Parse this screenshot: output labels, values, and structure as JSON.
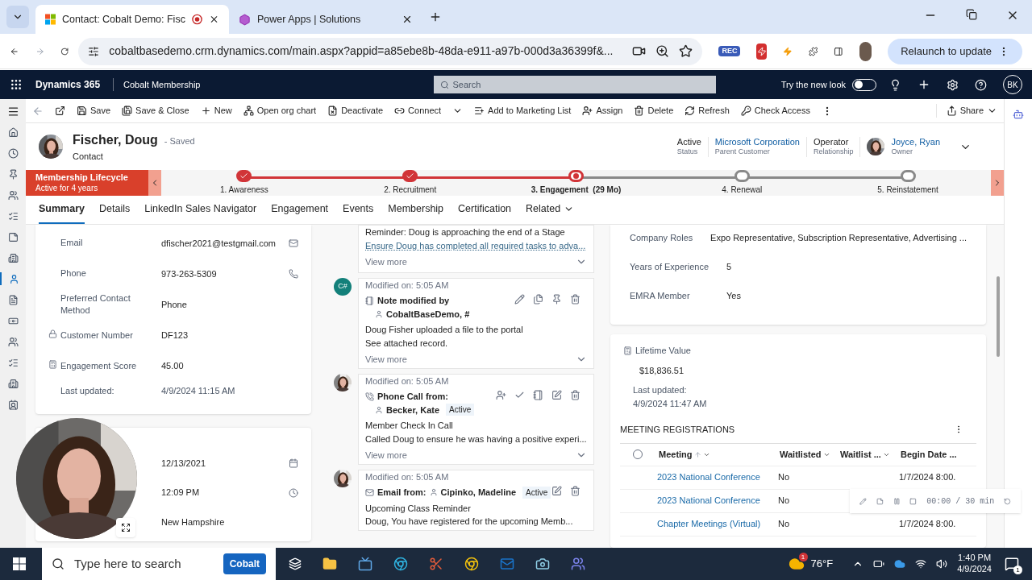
{
  "browser": {
    "tabs": [
      {
        "title": "Contact: Cobalt Demo: Fisc",
        "selected": true
      },
      {
        "title": "Power Apps | Solutions",
        "selected": false
      }
    ],
    "url": "cobaltbasedemo.crm.dynamics.com/main.aspx?appid=a85ebe8b-48da-e911-a97b-000d3a36399f&...",
    "rec": "REC",
    "relaunch": "Relaunch to update"
  },
  "app": {
    "name": "Dynamics 365",
    "area": "Cobalt Membership",
    "search_placeholder": "Search",
    "new_look": {
      "label": "Try the new look",
      "on": false
    },
    "user": "BK"
  },
  "nav_rail": [
    {
      "selected": false
    },
    {
      "selected": false
    },
    {
      "selected": false
    },
    {
      "selected": false
    },
    {
      "selected": false
    },
    {
      "selected": false
    },
    {
      "selected": false
    },
    {
      "selected": true
    },
    {
      "selected": false
    },
    {
      "selected": false
    },
    {
      "selected": false
    },
    {
      "selected": false
    },
    {
      "selected": false
    },
    {
      "selected": false
    }
  ],
  "commands": [
    {
      "kind": "save",
      "label": "Save"
    },
    {
      "kind": "saveclose",
      "label": "Save & Close"
    },
    {
      "kind": "new",
      "label": "New"
    },
    {
      "kind": "org",
      "label": "Open org chart"
    },
    {
      "kind": "deactivate",
      "label": "Deactivate"
    },
    {
      "kind": "connect",
      "label": "Connect"
    },
    {
      "kind": "list",
      "label": "Add to Marketing List"
    },
    {
      "kind": "assign",
      "label": "Assign"
    },
    {
      "kind": "delete",
      "label": "Delete"
    },
    {
      "kind": "refresh",
      "label": "Refresh"
    },
    {
      "kind": "access",
      "label": "Check Access"
    }
  ],
  "share": "Share",
  "record": {
    "name": "Fischer, Doug",
    "saved": "- Saved",
    "type": "Contact",
    "header_fields": [
      {
        "value": "Active",
        "label": "Status",
        "kind": "text"
      },
      {
        "value": "Microsoft Corporation",
        "label": "Parent Customer",
        "kind": "link"
      },
      {
        "value": "Operator",
        "label": "Relationship",
        "kind": "text"
      }
    ],
    "owner": {
      "name": "Joyce, Ryan",
      "label": "Owner"
    }
  },
  "bpf": {
    "title": "Membership Lifecycle",
    "subtitle": "Active for 4 years",
    "stages": [
      {
        "label": "1. Awareness",
        "completed": true,
        "selected": false
      },
      {
        "label": "2. Recruitment",
        "completed": true,
        "selected": false
      },
      {
        "label": "3. Engagement  (29 Mo)",
        "completed": false,
        "selected": true
      },
      {
        "label": "4. Renewal",
        "completed": false,
        "selected": false
      },
      {
        "label": "5. Reinstatement",
        "completed": false,
        "selected": false
      }
    ]
  },
  "form_tabs": [
    {
      "label": "Summary",
      "selected": true,
      "menu": false
    },
    {
      "label": "Details",
      "selected": false,
      "menu": false
    },
    {
      "label": "LinkedIn Sales Navigator",
      "selected": false,
      "menu": false
    },
    {
      "label": "Engagement",
      "selected": false,
      "menu": false
    },
    {
      "label": "Events",
      "selected": false,
      "menu": false
    },
    {
      "label": "Membership",
      "selected": false,
      "menu": false
    },
    {
      "label": "Certification",
      "selected": false,
      "menu": false
    },
    {
      "label": "Related",
      "selected": false,
      "menu": true
    }
  ],
  "contact_card": {
    "fields": [
      {
        "label": "Email",
        "value": "dfischer2021@testgmail.com",
        "kind": "email"
      },
      {
        "label": "Phone",
        "value": "973-263-5309",
        "kind": "phone"
      },
      {
        "label": "Preferred Contact Method",
        "value": "Phone",
        "kind": "choice"
      },
      {
        "label": "Customer Number",
        "value": "DF123",
        "kind": "locked"
      },
      {
        "label": "Engagement Score",
        "value": "45.00",
        "kind": "calculated"
      }
    ],
    "last_updated": {
      "label": "Last updated:",
      "value": "4/9/2024 11:15 AM"
    }
  },
  "second_card": {
    "fields": [
      {
        "value": "12/13/2021",
        "kind": "date"
      },
      {
        "value": "12:09 PM",
        "kind": "time"
      },
      {
        "value": "New Hampshire",
        "kind": "text"
      }
    ]
  },
  "timeline": [
    {
      "kind": "reminder",
      "lines": [
        "Reminder: Doug is approaching the end of a Stage"
      ],
      "link": "Ensure Doug has completed all required tasks to adva...",
      "view_more": "View more"
    },
    {
      "kind": "note",
      "avatar": {
        "kind": "initials",
        "text": "C#",
        "color": "#13807a"
      },
      "modified": "Modified on: 5:05 AM",
      "title": "Note modified by",
      "person": "CobaltBaseDemo, #",
      "lines": [
        "Doug Fisher uploaded a file to the portal",
        "See attached record."
      ],
      "view_more": "View more"
    },
    {
      "kind": "phone",
      "avatar": {
        "kind": "picture"
      },
      "modified": "Modified on: 5:05 AM",
      "title": "Phone Call from:",
      "person": "Becker, Kate",
      "status": "Active",
      "lines": [
        "Member Check In Call",
        "Called Doug to ensure he was having a positive experi..."
      ],
      "view_more": "View more"
    },
    {
      "kind": "email",
      "avatar": {
        "kind": "picture"
      },
      "modified": "Modified on: 5:05 AM",
      "title": "Email from:",
      "person": "Cipinko, Madeline",
      "status": "Active",
      "lines": [
        "Upcoming Class Reminder",
        "Doug,  You have registered for the upcoming Memb..."
      ]
    }
  ],
  "details_card": {
    "fields": [
      {
        "label": "Company Roles",
        "value": "Expo Representative, Subscription Representative, Advertising ..."
      },
      {
        "label": "Years of Experience",
        "value": "5"
      },
      {
        "label": "EMRA Member",
        "value": "Yes"
      }
    ]
  },
  "lifetime": {
    "label": "Lifetime Value",
    "value": "$18,836.51",
    "updated_label": "Last updated:",
    "updated": "4/9/2024 11:47 AM"
  },
  "registrations": {
    "title": "MEETING REGISTRATIONS",
    "select_all": {
      "checked": false
    },
    "columns": [
      {
        "label": "Meeting",
        "sorted": true
      },
      {
        "label": "Waitlisted",
        "sorted": false
      },
      {
        "label": "Waitlist ...",
        "sorted": false
      },
      {
        "label": "Begin Date ...",
        "sorted": false
      }
    ],
    "rows": [
      [
        "2023 National Conference",
        "No",
        "",
        "1/7/2024 8:00."
      ],
      [
        "2023 National Conference",
        "No",
        "",
        ""
      ],
      [
        "Chapter Meetings (Virtual)",
        "No",
        "",
        "1/7/2024 8:00."
      ]
    ]
  },
  "recorder": {
    "time": "00:00 / 30 min"
  },
  "taskbar": {
    "search_placeholder": "Type here to search",
    "brand": "Cobalt",
    "weather_badge": "1",
    "temperature": "76°F",
    "time": "1:40 PM",
    "date": "4/9/2024",
    "notifications": "1"
  }
}
